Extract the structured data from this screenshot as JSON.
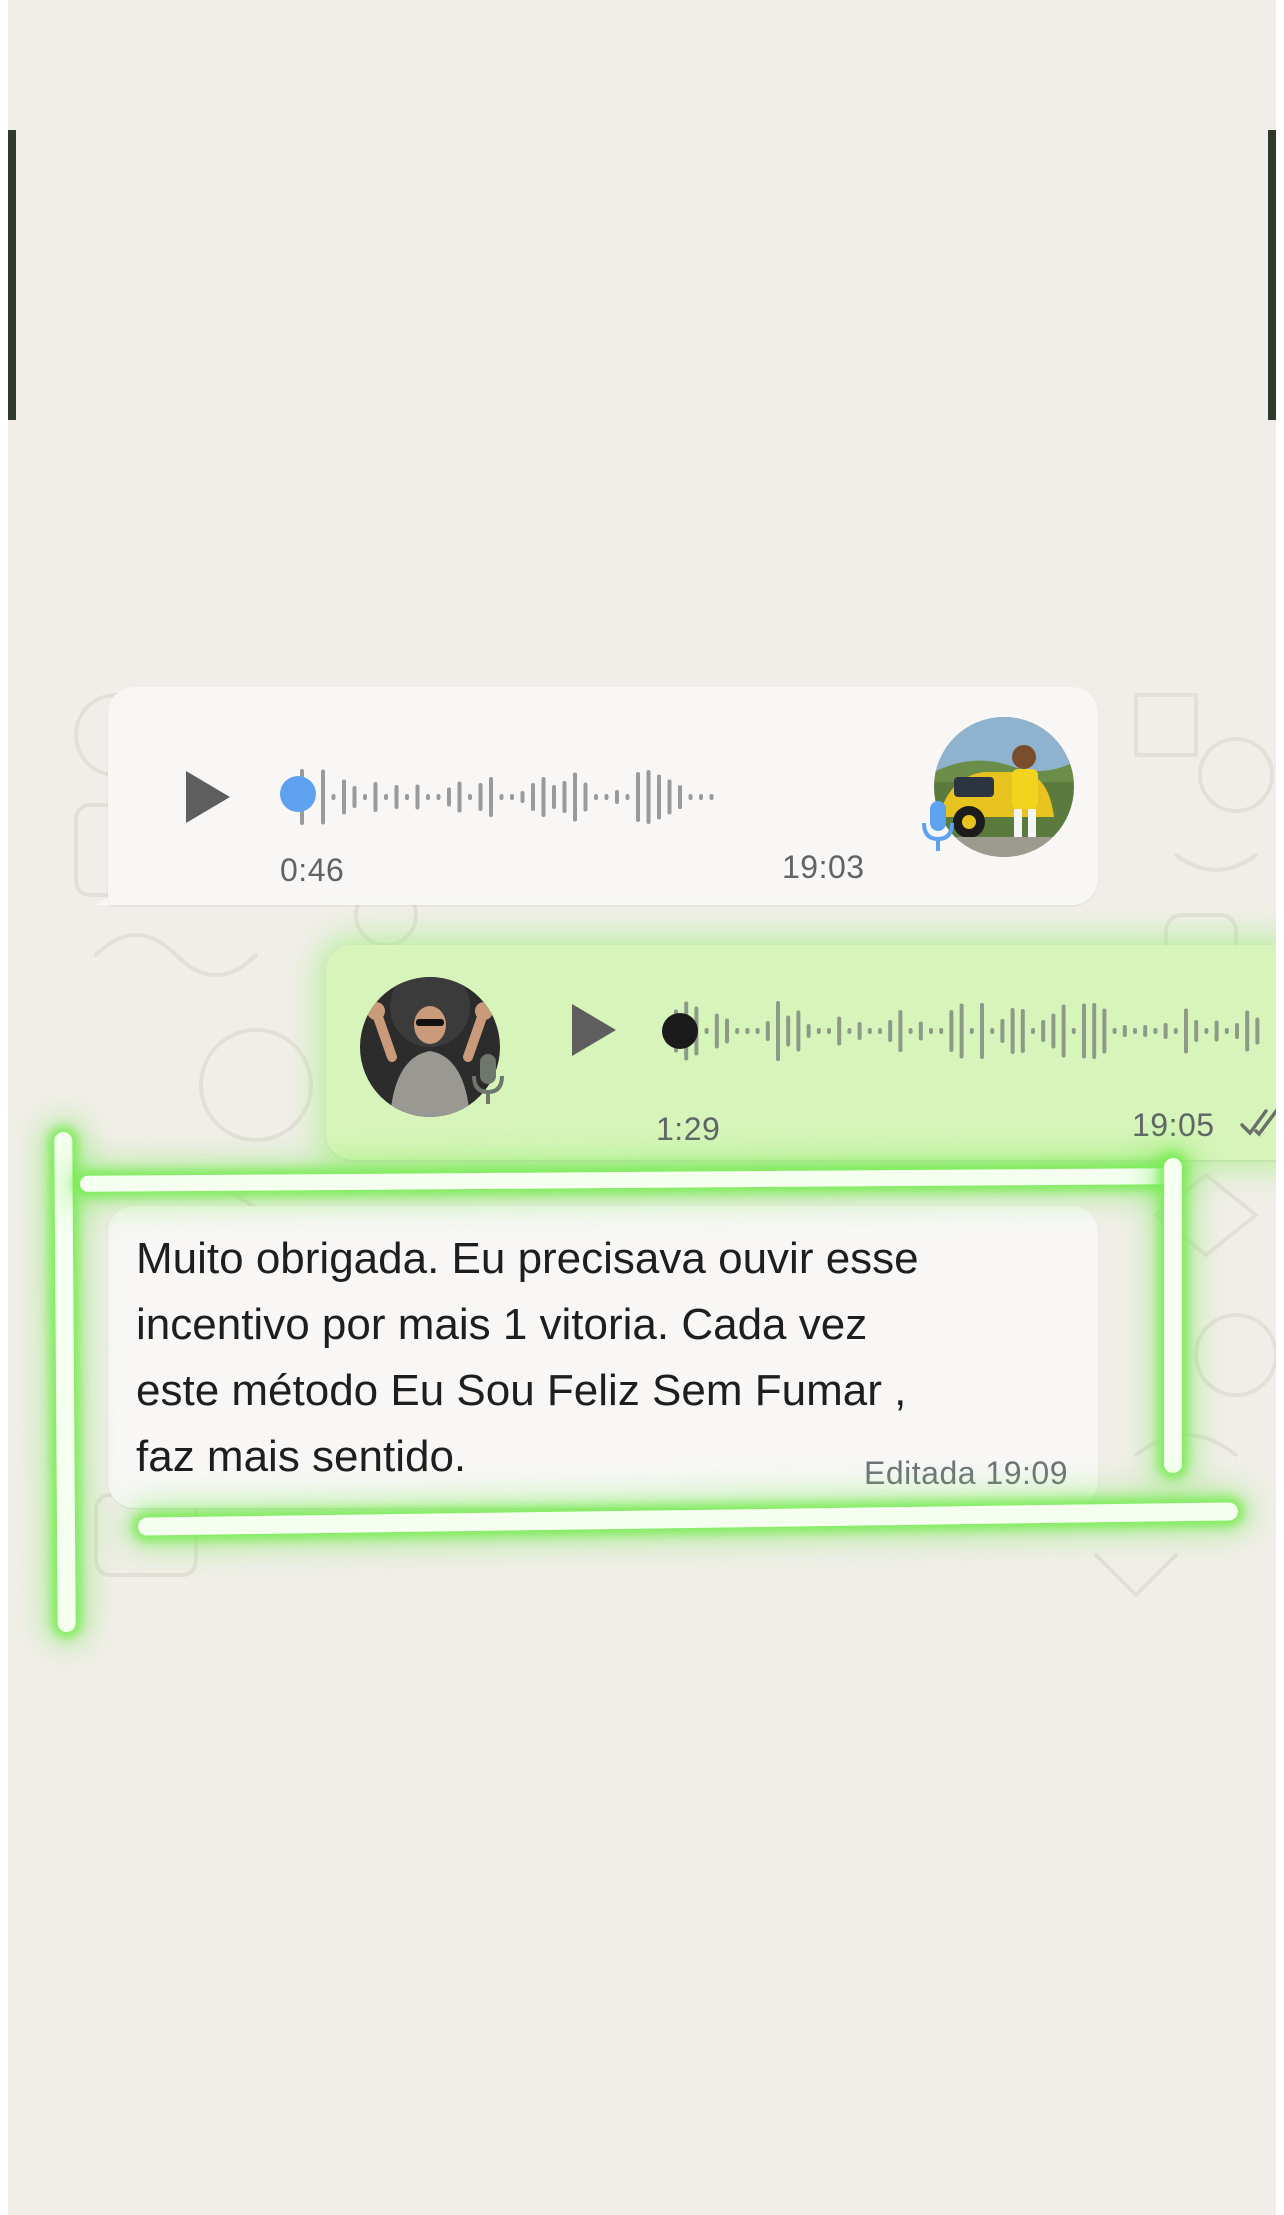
{
  "chat": {
    "voice_incoming": {
      "duration": "0:46",
      "time": "19:03",
      "progress": 0.0
    },
    "voice_outgoing": {
      "duration": "1:29",
      "time": "19:05",
      "status_icon": "double-check-icon",
      "progress": 0.0
    },
    "text_message": {
      "lines": [
        "Muito obrigada. Eu precisava ouvir esse",
        "incentivo por mais 1 vitoria. Cada vez",
        "este método Eu Sou Feliz Sem Fumar ,",
        "faz mais sentido."
      ],
      "edited_label": "Editada",
      "time": "19:09"
    }
  },
  "colors": {
    "chat_background": "#f1eee9",
    "incoming_bubble": "#f8f7f6",
    "outgoing_bubble": "#d7f5ba",
    "incoming_progress_dot": "#5ea2ef",
    "outgoing_progress_dot": "#1b1b1b",
    "highlight_glow": "#76eb50",
    "waveform": "#9a9a9a"
  }
}
